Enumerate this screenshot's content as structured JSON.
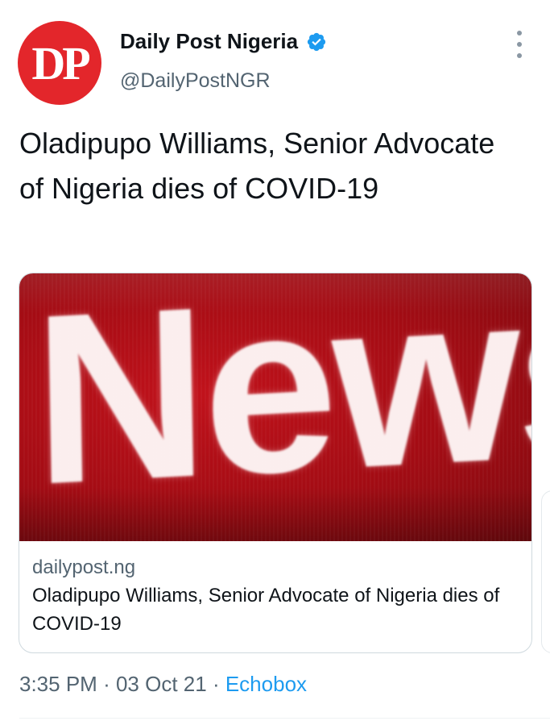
{
  "author": {
    "avatar_text": "DP",
    "display_name": "Daily Post Nigeria",
    "handle": "@DailyPostNGR",
    "verified": true
  },
  "tweet": {
    "text": "Oladipupo Williams, Senior Advocate of Nigeria dies of COVID-19"
  },
  "card": {
    "image_text": "News",
    "domain": "dailypost.ng",
    "title": "Oladipupo Williams, Senior Advocate of Nigeria dies of COVID-19"
  },
  "meta": {
    "time": "3:35 PM",
    "separator": "·",
    "date": "03 Oct 21",
    "source": "Echobox"
  },
  "icons": {
    "verified": "verified-badge-icon",
    "more": "more-options-icon"
  },
  "colors": {
    "brand_red": "#e3262b",
    "link_blue": "#1d9bf0",
    "secondary_text": "#536471"
  }
}
